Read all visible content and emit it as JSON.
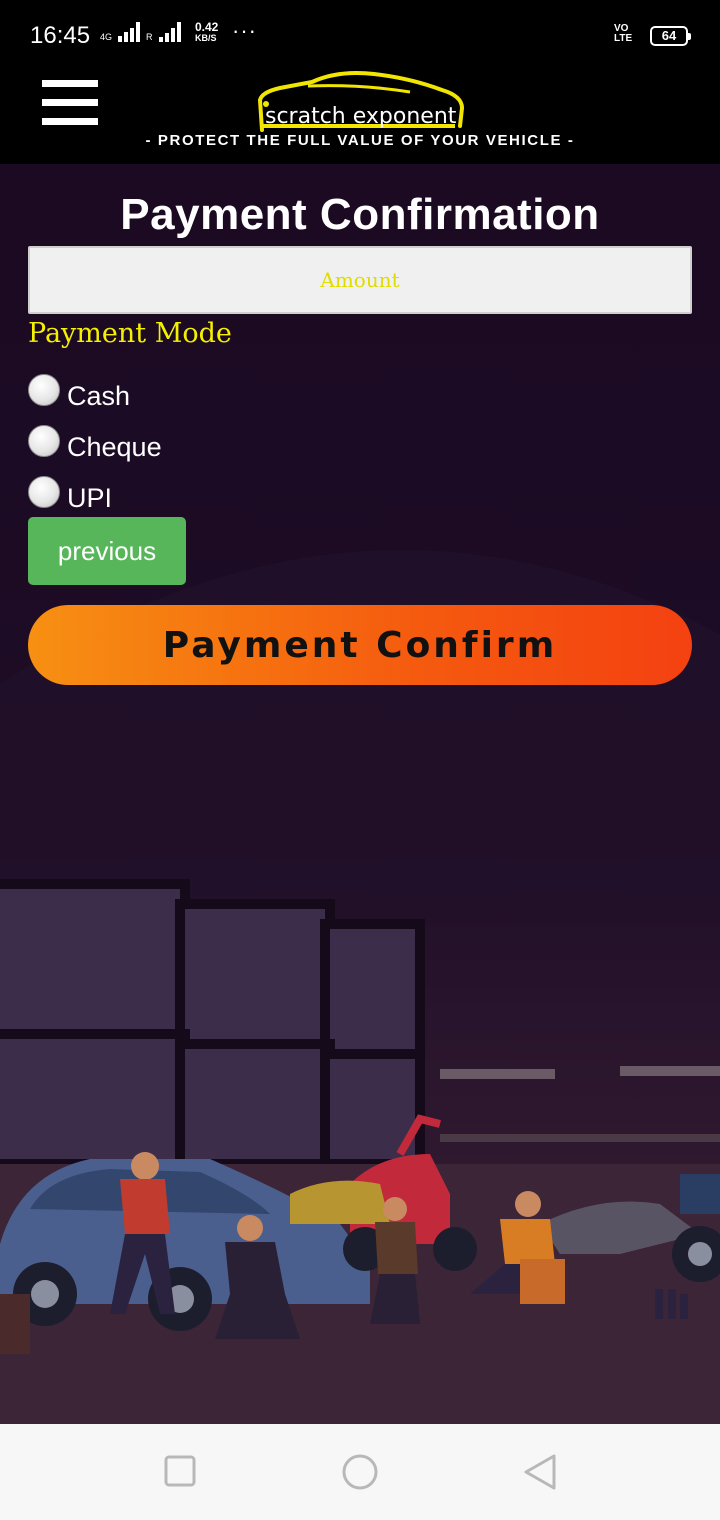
{
  "status_bar": {
    "time": "16:45",
    "network_type": "4G",
    "roaming": "R",
    "speed_value": "0.42",
    "speed_unit": "KB/S",
    "more": "···",
    "volte_top": "VO",
    "volte_bottom": "LTE",
    "battery": "64"
  },
  "header": {
    "logo_text": "scratch exponent",
    "tagline": "- PROTECT THE FULL VALUE OF YOUR VEHICLE -",
    "logo_color": "#f2e600"
  },
  "form": {
    "title": "Payment Confirmation",
    "amount_placeholder": "Amount",
    "amount_value": "",
    "payment_mode_label": "Payment Mode",
    "options": [
      {
        "label": "Cash",
        "selected": false
      },
      {
        "label": "Cheque",
        "selected": false
      },
      {
        "label": "UPI",
        "selected": false
      }
    ],
    "previous_label": "previous",
    "confirm_label": "Payment Confirm"
  },
  "colors": {
    "background": "#1b0a22",
    "accent_yellow": "#f4f000",
    "previous_green": "#57b65a",
    "confirm_orange_start": "#f79012",
    "confirm_orange_end": "#f44111"
  },
  "nav": {
    "icons": [
      "recent-apps-icon",
      "home-icon",
      "back-icon"
    ]
  }
}
